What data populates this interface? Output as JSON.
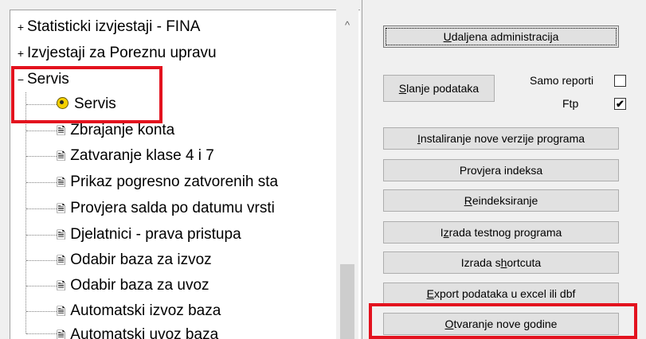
{
  "tree": {
    "items": [
      {
        "label": "Statisticki izvjestaji - FINA",
        "expander": "+"
      },
      {
        "label": "Izvjestaji za Poreznu upravu",
        "expander": "+"
      },
      {
        "label": "Servis",
        "expander": "−"
      },
      {
        "label": "Servis"
      },
      {
        "label": "Zbrajanje konta"
      },
      {
        "label": "Zatvaranje klase 4 i 7"
      },
      {
        "label": "Prikaz pogresno zatvorenih sta"
      },
      {
        "label": "Provjera salda po datumu vrsti"
      },
      {
        "label": "Djelatnici - prava pristupa"
      },
      {
        "label": "Odabir baza za izvoz"
      },
      {
        "label": "Odabir baza za uvoz"
      },
      {
        "label": "Automatski izvoz baza"
      },
      {
        "label": "Automatski uvoz baza"
      }
    ]
  },
  "buttons": {
    "udaljena": {
      "pre": "",
      "key": "U",
      "post": "daljena administracija"
    },
    "slanje": {
      "pre": "",
      "key": "S",
      "post": "lanje podataka"
    },
    "instaliranje": {
      "pre": "",
      "key": "I",
      "post": "nstaliranje nove verzije programa"
    },
    "provjera": {
      "pre": "Provjera indeksa",
      "key": "",
      "post": ""
    },
    "reindeksiranje": {
      "pre": "",
      "key": "R",
      "post": "eindeksiranje"
    },
    "izrada_testnog": {
      "pre": "I",
      "key": "z",
      "post": "rada testnog programa"
    },
    "izrada_shortcuta": {
      "pre": "Izrada s",
      "key": "h",
      "post": "ortcuta"
    },
    "export": {
      "pre": "",
      "key": "E",
      "post": "xport podataka u excel ili dbf"
    },
    "otvaranje": {
      "pre": "",
      "key": "O",
      "post": "tvaranje nove godine"
    }
  },
  "checks": {
    "samo_reporti": {
      "label": "Samo reporti",
      "checked": ""
    },
    "ftp": {
      "label": "Ftp",
      "checked": "✔"
    }
  },
  "colors": {
    "highlight": "#e3121e"
  }
}
